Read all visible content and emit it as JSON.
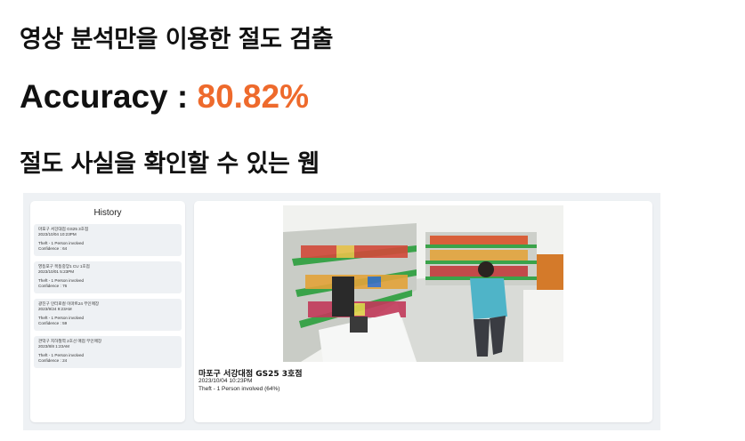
{
  "heading": "영상 분석만을 이용한 절도 검출",
  "accuracy": {
    "label": "Accuracy : ",
    "value": "80.82%"
  },
  "subheading": "절도 사실을 확인할 수 있는 웹",
  "app": {
    "history_title": "History",
    "history": [
      {
        "store": "마포구 서강대점 GS25 3호점",
        "datetime": "2023/10/04 10:23PM",
        "event": "Theft - 1 Person involved",
        "confidence": "Confidence : 64"
      },
      {
        "store": "영등포구 목동중앙1 CU 1호점",
        "datetime": "2023/10/01 5:23PM",
        "event": "Theft - 1 Person involved",
        "confidence": "Confidence : 76"
      },
      {
        "store": "광진구 인터로컬 이마트24 무인매장",
        "datetime": "2023/9/24 9:23AM",
        "event": "Theft - 1 Person involved",
        "confidence": "Confidence : 59"
      },
      {
        "store": "관악구 지하철역 2호선 매점 무인매장",
        "datetime": "2023/8/8 1:23AM",
        "event": "Theft - 1 Person involved",
        "confidence": "Confidence : 24"
      }
    ],
    "detail": {
      "store": "마포구 서강대점 GS25 3호점",
      "datetime": "2023/10/04 10:23PM",
      "description": "Theft - 1 Person involved (64%)"
    }
  },
  "colors": {
    "accent": "#ee6a2c",
    "panel_bg": "#eef1f4"
  }
}
